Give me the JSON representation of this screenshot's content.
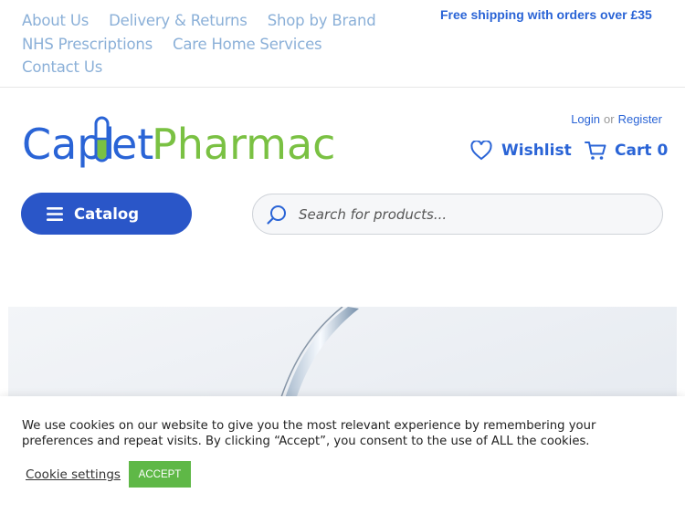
{
  "top_nav": {
    "row1": [
      {
        "label": "About Us"
      },
      {
        "label": "Delivery & Returns"
      },
      {
        "label": "Shop by Brand"
      }
    ],
    "row2": [
      {
        "label": "NHS Prescriptions"
      },
      {
        "label": "Care Home Services"
      }
    ],
    "row3": [
      {
        "label": "Contact Us"
      }
    ]
  },
  "shipping_banner": "Free shipping with orders over £35",
  "logo": {
    "part1": "Capl",
    "part2": "et",
    "part3": "Pharmacy"
  },
  "account": {
    "login": "Login",
    "or": "or",
    "register": "Register"
  },
  "wishlist": {
    "label": "Wishlist"
  },
  "cart": {
    "label": "Cart",
    "count": "0"
  },
  "catalog": {
    "label": "Catalog"
  },
  "search": {
    "placeholder": "Search for products..."
  },
  "cookie": {
    "message": "We use cookies on our website to give you the most relevant experience by remembering your preferences and repeat visits. By clicking “Accept”, you consent to the use of ALL the cookies.",
    "settings_label": "Cookie settings",
    "accept_label": "ACCEPT"
  },
  "colors": {
    "brand_blue": "#2a64d6",
    "brand_green": "#7ac143",
    "link_blue": "#8bb0d8",
    "accept_green": "#5fb847"
  }
}
